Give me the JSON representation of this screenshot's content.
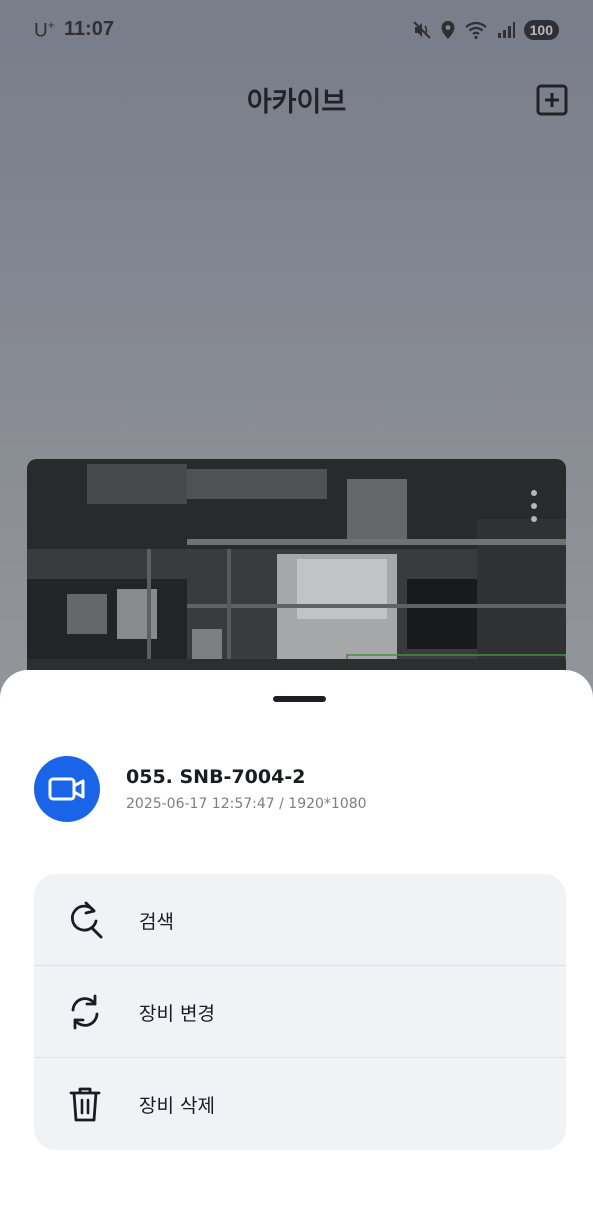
{
  "status_bar": {
    "carrier": "U",
    "carrier_plus": "+",
    "time": "11:07",
    "battery": "100",
    "icons": [
      "mute-vibrate-icon",
      "location-icon",
      "wifi-icon",
      "signal-icon"
    ]
  },
  "header": {
    "title": "아카이브",
    "add_icon": "plus-square-icon"
  },
  "preview": {
    "more_icon": "more-vertical-icon"
  },
  "sheet": {
    "device": {
      "icon": "video-camera-icon",
      "accent": "#1a64e8",
      "name": "055. SNB-7004-2",
      "meta": "2025-06-17 12:57:47 / 1920*1080"
    },
    "menu": [
      {
        "label": "검색",
        "icon": "search-refresh-icon"
      },
      {
        "label": "장비 변경",
        "icon": "refresh-icon"
      },
      {
        "label": "장비 삭제",
        "icon": "trash-icon"
      }
    ]
  }
}
